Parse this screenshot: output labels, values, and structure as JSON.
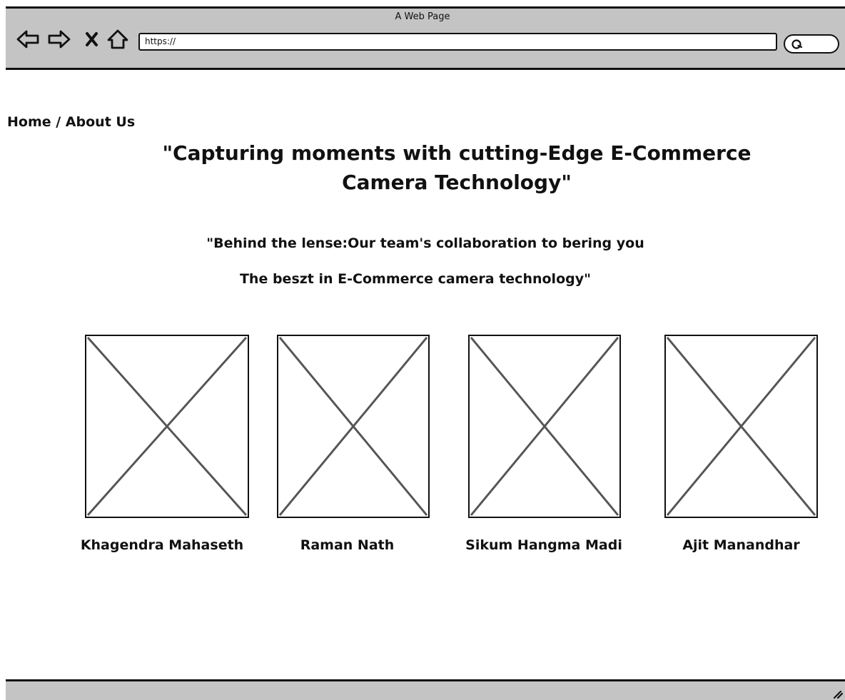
{
  "window": {
    "title": "A Web Page",
    "address": "https://"
  },
  "toolbar": {
    "icons": [
      "back-arrow-icon",
      "forward-arrow-icon",
      "close-x-icon",
      "home-icon",
      "search-icon"
    ]
  },
  "breadcrumb": "Home / About Us",
  "headline": "\"Capturing moments with cutting-Edge E-Commerce Camera Technology\"",
  "tagline": {
    "line1": "\"Behind the lense:Our team's collaboration to bering you",
    "line2": "The beszt in E-Commerce camera technology\""
  },
  "team": [
    {
      "name": "Khagendra Mahaseth"
    },
    {
      "name": "Raman Nath"
    },
    {
      "name": "Sikum Hangma Madi"
    },
    {
      "name": "Ajit Manandhar"
    }
  ],
  "colors": {
    "chrome": "#c4c4c4",
    "ink": "#111111",
    "placeholder_line": "#555555"
  }
}
